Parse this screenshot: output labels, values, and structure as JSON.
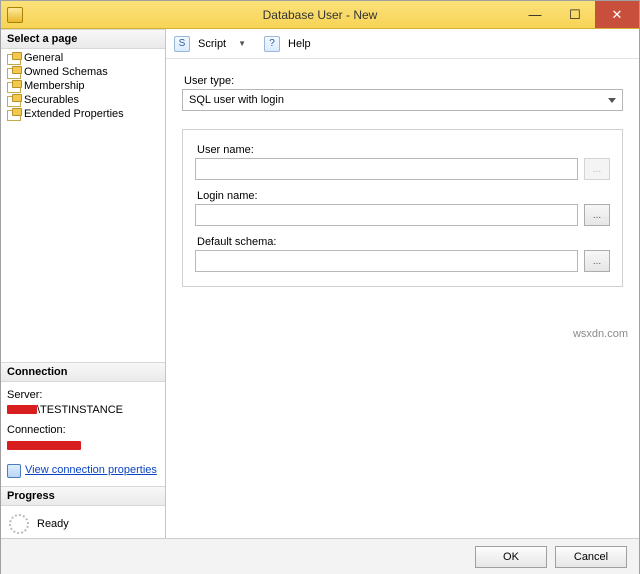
{
  "window": {
    "title": "Database User - New"
  },
  "sidebar": {
    "select_page_header": "Select a page",
    "pages": [
      {
        "label": "General"
      },
      {
        "label": "Owned Schemas"
      },
      {
        "label": "Membership"
      },
      {
        "label": "Securables"
      },
      {
        "label": "Extended Properties"
      }
    ],
    "connection_header": "Connection",
    "server_label": "Server:",
    "server_value_suffix": "\\TESTINSTANCE",
    "connection_label": "Connection:",
    "view_props_link": "View connection properties",
    "progress_header": "Progress",
    "progress_status": "Ready"
  },
  "toolbar": {
    "script_label": "Script",
    "help_label": "Help"
  },
  "form": {
    "user_type_label": "User type:",
    "user_type_value": "SQL user with login",
    "user_name_label": "User name:",
    "user_name_value": "",
    "login_name_label": "Login name:",
    "login_name_value": "",
    "default_schema_label": "Default schema:",
    "default_schema_value": "",
    "browse_label": "..."
  },
  "footer": {
    "ok": "OK",
    "cancel": "Cancel"
  },
  "watermark": "wsxdn.com"
}
